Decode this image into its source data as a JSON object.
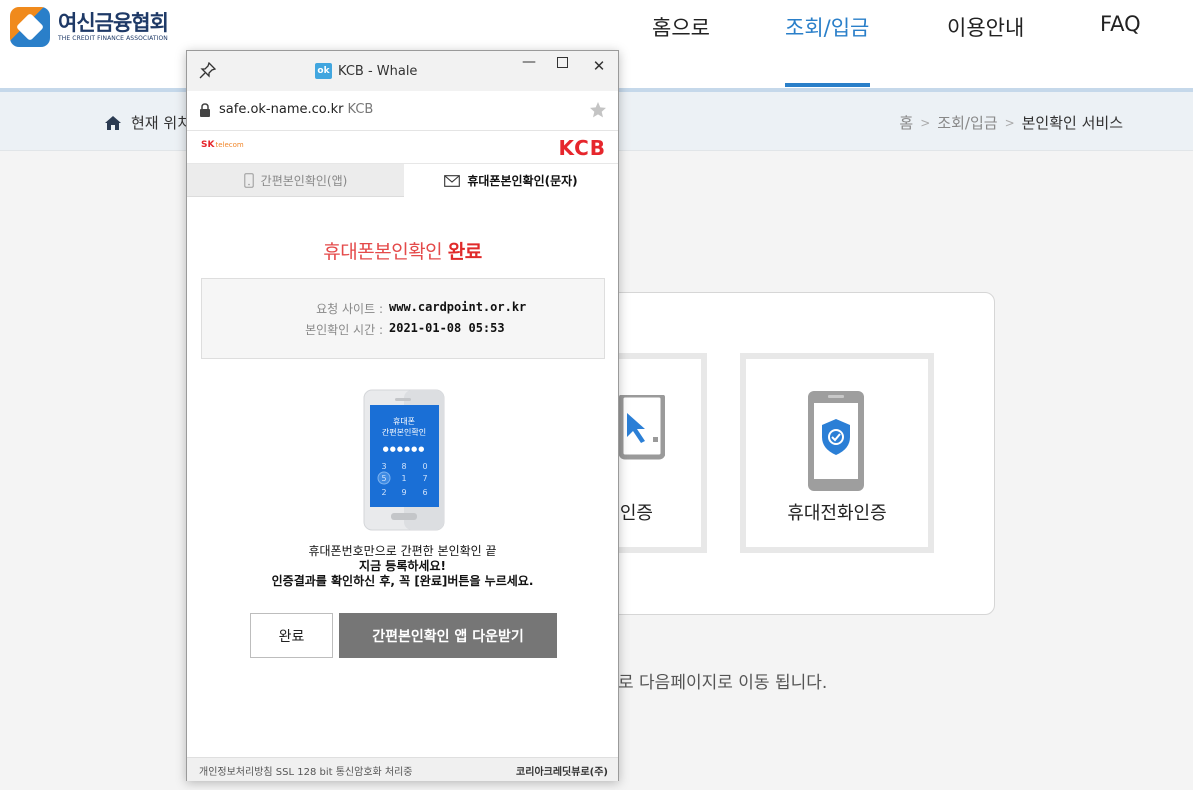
{
  "site": {
    "logo_ko": "여신금융협회",
    "logo_en": "THE CREDIT FINANCE ASSOCIATION",
    "nav": [
      "홈으로",
      "조회/입금",
      "이용안내",
      "FAQ"
    ],
    "active_nav": "조회/입금",
    "location_label": "현재 위치",
    "breadcrumb": [
      "홈",
      "조회/입금",
      "본인확인 서비스"
    ],
    "cert_options": [
      "인증",
      "휴대전화인증"
    ],
    "notice_text": "로 다음페이지로 이동 됩니다.",
    "accent_color": "#2a7fc9"
  },
  "popup": {
    "window_title": "KCB - Whale",
    "title_badge": "ok",
    "url": "safe.ok-name.co.kr",
    "url_site": "KCB",
    "sk_logo": {
      "sk": "SK",
      "telecom": "telecom"
    },
    "kcb_logo": "KCB",
    "tabs": [
      {
        "label": "간편본인확인(앱)",
        "active": false
      },
      {
        "label": "휴대폰본인확인(문자)",
        "active": true
      }
    ],
    "title_normal": "휴대폰본인확인",
    "title_bold": "완료",
    "info": [
      {
        "key": "요청 사이트 :",
        "value": "www.cardpoint.or.kr"
      },
      {
        "key": "본인확인 시간 :",
        "value": "2021-01-08 05:53"
      }
    ],
    "phone_screen": {
      "line1": "휴대폰",
      "line2": "간편본인확인",
      "pin_dots": "●●●●●●",
      "keypad": [
        "3",
        "8",
        "0",
        "5",
        "1",
        "7",
        "2",
        "9",
        "6"
      ]
    },
    "promo": [
      "휴대폰번호만으로 간편한 본인확인 끝",
      "지금 등록하세요!",
      "인증결과를 확인하신 후, 꼭 [완료]버튼을 누르세요."
    ],
    "button_done": "완료",
    "button_download": "간편본인확인 앱 다운받기",
    "footer_left": "개인정보처리방침   SSL 128 bit 통신암호화 처리중",
    "footer_right": "코리아크레딧뷰로(주)",
    "brand_red": "#e6262c",
    "phone_blue": "#1a6fd6"
  }
}
